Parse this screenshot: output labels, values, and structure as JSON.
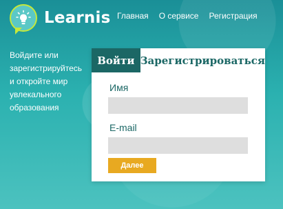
{
  "brand": {
    "name": "Learnis",
    "icon": "lightbulb-icon"
  },
  "nav": {
    "items": [
      {
        "label": "Главная"
      },
      {
        "label": "О сервисе"
      },
      {
        "label": "Регистрация"
      }
    ]
  },
  "promo": {
    "text": "Войдите или зарегистрируйтесь и откройте мир увлекального образования"
  },
  "auth": {
    "tabs": {
      "login": "Войти",
      "register": "Зарегистрироваться"
    },
    "fields": {
      "name_label": "Имя",
      "name_value": "",
      "email_label": "E-mail",
      "email_value": ""
    },
    "submit_label": "Далее"
  },
  "colors": {
    "accent_dark": "#1b6765",
    "button": "#e8a921",
    "logo_ring": "#c6e83a"
  }
}
